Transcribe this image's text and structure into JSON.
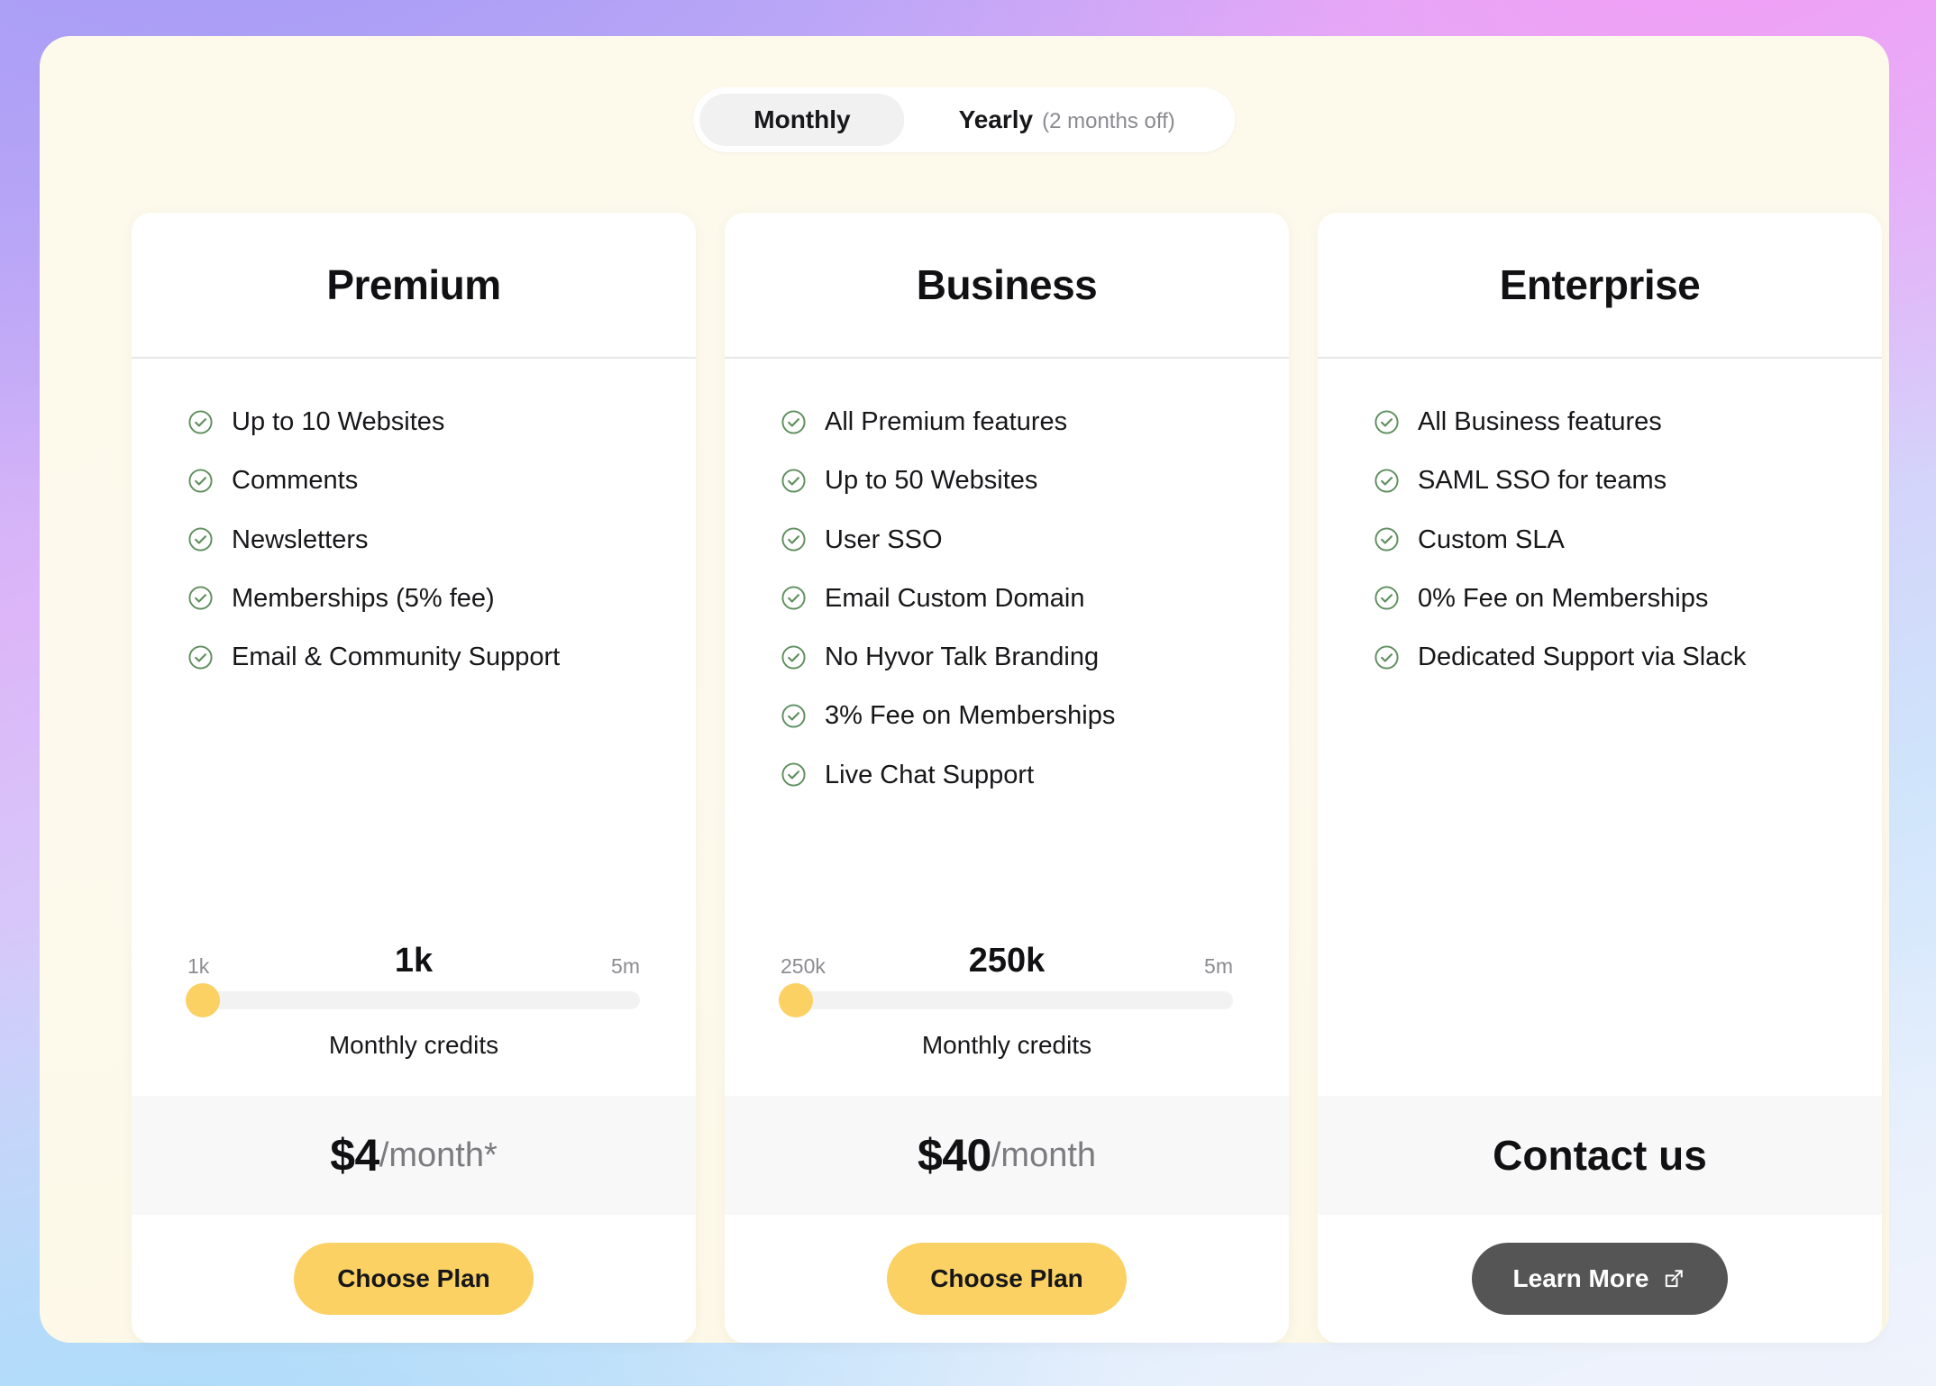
{
  "billing_toggle": {
    "options": [
      {
        "label": "Monthly",
        "note": "",
        "active": true
      },
      {
        "label": "Yearly",
        "note": "(2 months off)",
        "active": false
      }
    ]
  },
  "colors": {
    "accent_yellow": "#fad162",
    "check_green": "#5f8f5f",
    "dark_button": "#555555",
    "panel_cream": "#fdfaec",
    "price_band": "#f8f8f8"
  },
  "plans": [
    {
      "name": "Premium",
      "features": [
        "Up to 10 Websites",
        "Comments",
        "Newsletters",
        "Memberships (5% fee)",
        "Email & Community Support"
      ],
      "slider": {
        "min_label": "1k",
        "max_label": "5m",
        "value_label": "1k",
        "caption": "Monthly credits",
        "thumb_percent": 0
      },
      "price": {
        "amount": "$4",
        "period": "/month*"
      },
      "cta": {
        "label": "Choose Plan",
        "style": "primary",
        "icon": ""
      }
    },
    {
      "name": "Business",
      "features": [
        "All Premium features",
        "Up to 50 Websites",
        "User SSO",
        "Email Custom Domain",
        "No Hyvor Talk Branding",
        "3% Fee on Memberships",
        "Live Chat Support"
      ],
      "slider": {
        "min_label": "250k",
        "max_label": "5m",
        "value_label": "250k",
        "caption": "Monthly credits",
        "thumb_percent": 0
      },
      "price": {
        "amount": "$40",
        "period": "/month"
      },
      "cta": {
        "label": "Choose Plan",
        "style": "primary",
        "icon": ""
      }
    },
    {
      "name": "Enterprise",
      "features": [
        "All Business features",
        "SAML SSO for teams",
        "Custom SLA",
        "0% Fee on Memberships",
        "Dedicated Support via Slack"
      ],
      "slider": null,
      "price": {
        "amount": "Contact us",
        "period": ""
      },
      "cta": {
        "label": "Learn More",
        "style": "dark",
        "icon": "external-link-icon"
      }
    }
  ]
}
